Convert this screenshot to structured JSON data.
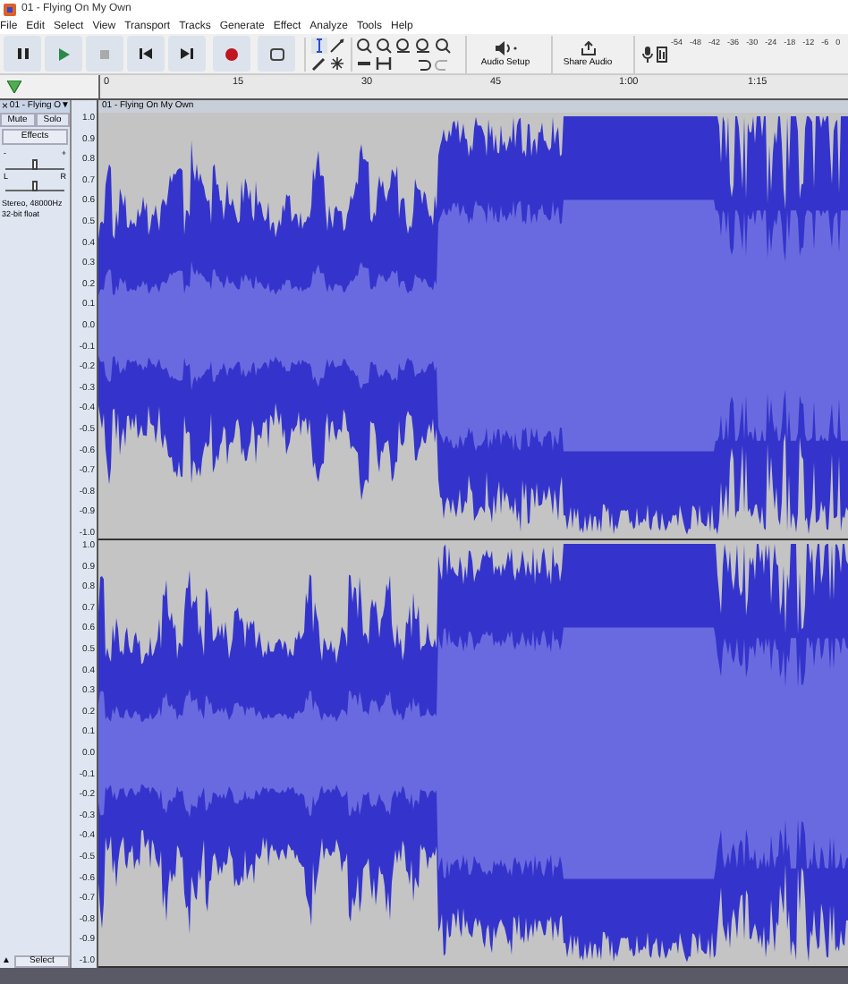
{
  "window": {
    "title": "01 - Flying On My Own"
  },
  "menu": [
    "File",
    "Edit",
    "Select",
    "View",
    "Transport",
    "Tracks",
    "Generate",
    "Effect",
    "Analyze",
    "Tools",
    "Help"
  ],
  "toolbar": {
    "audio_setup": "Audio Setup",
    "share_audio": "Share Audio"
  },
  "meter": {
    "ticks": [
      "-54",
      "-48",
      "-42",
      "-36",
      "-30",
      "-24",
      "-18",
      "-12",
      "-6",
      "0"
    ]
  },
  "ruler": {
    "labels": [
      "0",
      "15",
      "30",
      "45",
      "1:00",
      "1:15"
    ]
  },
  "track": {
    "close": "×",
    "name": "01 - Flying O",
    "dropdown": "▼",
    "clip_title": "01 - Flying On My Own",
    "mute": "Mute",
    "solo": "Solo",
    "effects": "Effects",
    "gain": {
      "min": "-",
      "max": "+",
      "level": 0.5
    },
    "pan": {
      "min": "L",
      "max": "R",
      "level": 0.5
    },
    "format": "Stereo, 48000Hz",
    "sample_format": "32-bit float",
    "collapse": "▲",
    "select": "Select",
    "channels": [
      {
        "scale": [
          "1.0",
          "0.9",
          "0.8",
          "0.7",
          "0.6",
          "0.5",
          "0.4",
          "0.3",
          "0.2",
          "0.1",
          "0.0",
          "-0.1",
          "-0.2",
          "-0.3",
          "-0.4",
          "-0.5",
          "-0.6",
          "-0.7",
          "-0.8",
          "-0.9",
          "-1.0"
        ]
      },
      {
        "scale": [
          "1.0",
          "0.9",
          "0.8",
          "0.7",
          "0.6",
          "0.5",
          "0.4",
          "0.3",
          "0.2",
          "0.1",
          "0.0",
          "-0.1",
          "-0.2",
          "-0.3",
          "-0.4",
          "-0.5",
          "-0.6",
          "-0.7",
          "-0.8",
          "-0.9",
          "-1.0"
        ]
      }
    ]
  }
}
